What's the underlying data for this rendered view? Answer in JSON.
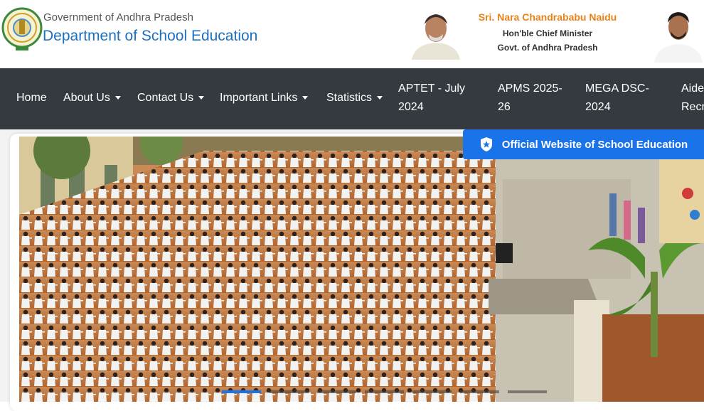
{
  "header": {
    "gov_line": "Government of Andhra Pradesh",
    "department": "Department of School Education",
    "cm_name": "Sri. Nara Chandrababu Naidu",
    "cm_role": "Hon'ble Chief Minister",
    "cm_govt": "Govt. of Andhra Pradesh"
  },
  "nav": {
    "home": "Home",
    "about": "About Us",
    "contact": "Contact Us",
    "links": "Important Links",
    "stats": "Statistics",
    "aptet_1": "APTET - July",
    "aptet_2": "2024",
    "apms_1": "APMS 2025-",
    "apms_2": "26",
    "dsc_1": "MEGA DSC-",
    "dsc_2": "2024",
    "aided_1": "Aided",
    "aided_2": "Recru"
  },
  "banner": {
    "official": "Official Website of School Education",
    "active_slide": 1,
    "slide_count": 7
  },
  "colors": {
    "nav_bg": "#343a40",
    "accent_blue": "#1a73e8",
    "dept_blue": "#1f6fbf",
    "cm_orange": "#e8821a"
  }
}
